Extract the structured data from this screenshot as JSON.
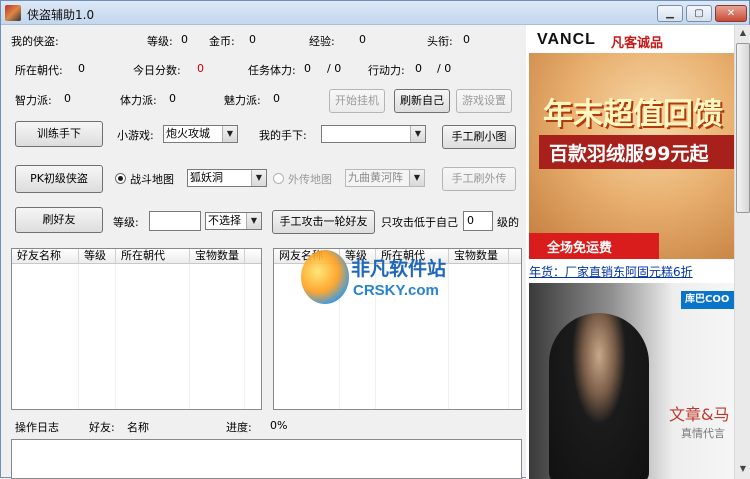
{
  "window": {
    "title": "侠盗辅助1.0",
    "min_label": "▁",
    "max_label": "▢",
    "close_label": "✕"
  },
  "stats": {
    "row1": [
      {
        "label": "我的侠盗:",
        "value": ""
      },
      {
        "label": "等级:",
        "value": "0"
      },
      {
        "label": "金币:",
        "value": "0"
      },
      {
        "label": "经验:",
        "value": "0"
      },
      {
        "label": "头衔:",
        "value": "0"
      }
    ],
    "row2": [
      {
        "label": "所在朝代:",
        "value": "0"
      },
      {
        "label": "今日分数:",
        "value": "0"
      },
      {
        "label": "任务体力:",
        "value": "0",
        "max": "/ 0"
      },
      {
        "label": "行动力:",
        "value": "0",
        "max": "/ 0"
      }
    ],
    "row3": [
      {
        "label": "智力派:",
        "value": "0"
      },
      {
        "label": "体力派:",
        "value": "0"
      },
      {
        "label": "魅力派:",
        "value": "0"
      }
    ]
  },
  "buttons": {
    "start_hangup": "开始挂机",
    "refresh_self": "刷新自己",
    "game_settings": "游戏设置",
    "train_minion": "训练手下",
    "manual_map": "手工刷小图",
    "pk_primary": "PK初级侠盗",
    "manual_outer": "手工刷外传",
    "refresh_friends": "刷好友",
    "manual_attack": "手工攻击一轮好友"
  },
  "controls": {
    "minigame_label": "小游戏:",
    "minigame_value": "炮火攻城",
    "my_minion_label": "我的手下:",
    "my_minion_value": "",
    "battle_map_label": "战斗地图",
    "battle_map_value": "狐妖洞",
    "outer_map_label": "外传地图",
    "outer_map_value": "九曲黄河阵",
    "level_label": "等级:",
    "level_input": "",
    "level_filter": "不选择",
    "attack_below_label": "只攻击低于自己",
    "attack_below_value": "0",
    "attack_below_suffix": "级的"
  },
  "friends_list": {
    "columns": [
      "好友名称",
      "等级",
      "所在朝代",
      "宝物数量"
    ]
  },
  "net_list": {
    "columns": [
      "网友名称",
      "等级",
      "所在朝代",
      "宝物数量"
    ]
  },
  "status": {
    "log_label": "操作日志",
    "friend_label": "好友:",
    "friend_value": "名称",
    "progress_label": "进度:",
    "progress_value": "0%"
  },
  "ad": {
    "brand": "VANCL",
    "brand_cn": "凡客诚品",
    "headline": "年末超值回馈",
    "subline": "百款羽绒服99元起",
    "shipping": "全场免运费",
    "link": "年货：厂家直销东阿固元糕6折",
    "logo2": "库巴COO",
    "text2": "文章&马",
    "text3": "真情代言"
  },
  "watermark": {
    "cn": "非凡软件站",
    "en": "CRSKY.com"
  },
  "colors": {
    "title_bar": "#c4d7ee",
    "highlight_value": "#d00000",
    "ad_red": "#d91c1c",
    "link": "#0033aa"
  }
}
